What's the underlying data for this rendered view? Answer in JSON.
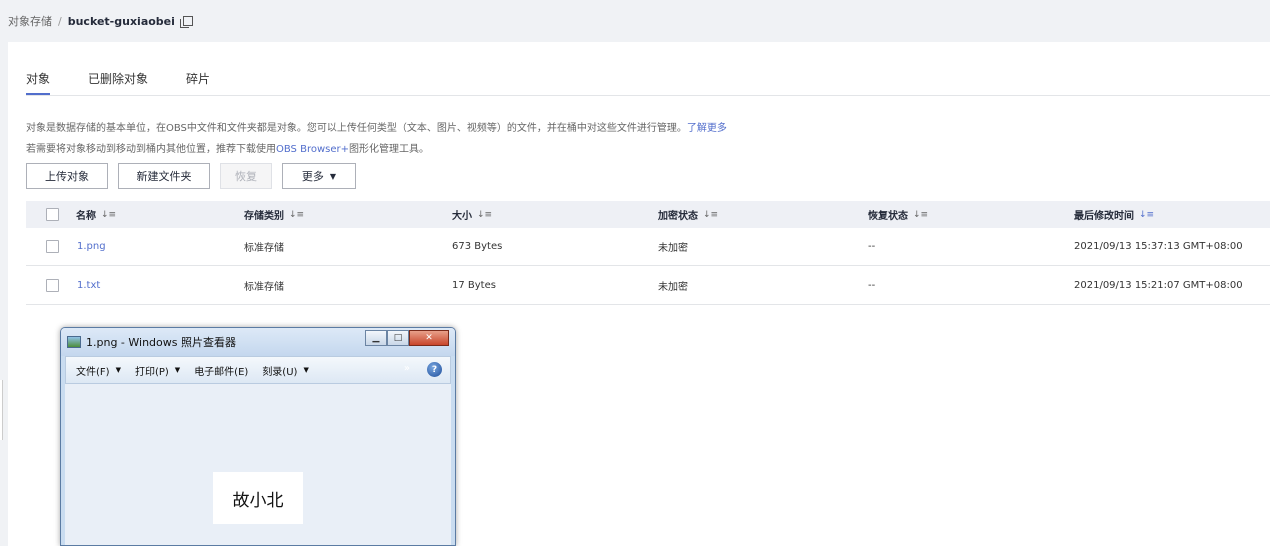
{
  "breadcrumb": {
    "parent": "对象存储",
    "separator": "/",
    "current": "bucket-guxiaobei"
  },
  "tabs": [
    {
      "label": "对象",
      "active": true
    },
    {
      "label": "已删除对象",
      "active": false
    },
    {
      "label": "碎片",
      "active": false
    }
  ],
  "description": {
    "line1": "对象是数据存储的基本单位，在OBS中文件和文件夹都是对象。您可以上传任何类型（文本、图片、视频等）的文件，并在桶中对这些文件进行管理。",
    "line1_link": "了解更多",
    "line2_pre": "若需要将对象移动到移动到桶内其他位置，推荐下载使用",
    "line2_link": "OBS Browser+",
    "line2_post": "图形化管理工具。"
  },
  "toolbar": {
    "upload": "上传对象",
    "new_folder": "新建文件夹",
    "restore": "恢复",
    "more": "更多"
  },
  "table": {
    "headers": {
      "name": "名称",
      "storage_class": "存储类别",
      "size": "大小",
      "encryption": "加密状态",
      "restore_status": "恢复状态",
      "last_modified": "最后修改时间"
    },
    "rows": [
      {
        "name": "1.png",
        "storage_class": "标准存储",
        "size": "673 Bytes",
        "encryption": "未加密",
        "restore_status": "--",
        "last_modified": "2021/09/13 15:37:13 GMT+08:00"
      },
      {
        "name": "1.txt",
        "storage_class": "标准存储",
        "size": "17 Bytes",
        "encryption": "未加密",
        "restore_status": "--",
        "last_modified": "2021/09/13 15:21:07 GMT+08:00"
      }
    ]
  },
  "viewer": {
    "title": "1.png - Windows 照片查看器",
    "menu": [
      {
        "label": "文件(F)",
        "dropdown": true
      },
      {
        "label": "打印(P)",
        "dropdown": true
      },
      {
        "label": "电子邮件(E)",
        "dropdown": false
      },
      {
        "label": "刻录(U)",
        "dropdown": true
      }
    ],
    "image_text": "故小北",
    "help": "?",
    "chevrons": "»"
  },
  "colors": {
    "accent": "#526ecc",
    "header_bg": "#eef0f5",
    "page_bg": "#f0f2f5"
  }
}
